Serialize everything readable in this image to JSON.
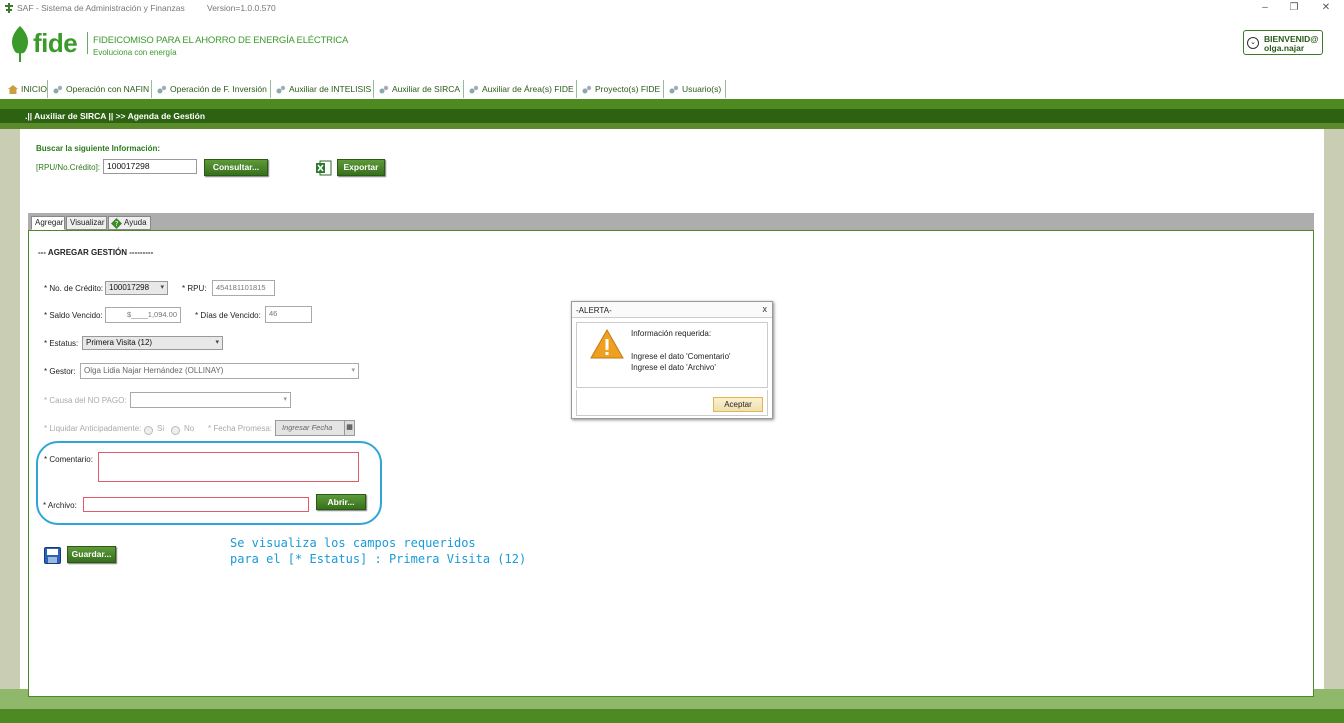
{
  "window": {
    "title": "SAF - Sistema de Administración y Finanzas",
    "version": "Version=1.0.0.570",
    "controls": [
      "–",
      "❐",
      "✕"
    ]
  },
  "brand": {
    "name": "fide",
    "line1": "FIDEICOMISO PARA EL AHORRO DE ENERGÍA ELÉCTRICA",
    "line2": "Evoluciona con energía",
    "color": "#3a9a2a"
  },
  "user": {
    "greeting": "BIENVENID@",
    "username": "olga.najar"
  },
  "menu": [
    {
      "label": "INICIO",
      "icon": "home-icon"
    },
    {
      "label": "Operación con NAFIN",
      "icon": "gears-icon"
    },
    {
      "label": "Operación de F. Inversión",
      "icon": "gears-icon"
    },
    {
      "label": "Auxiliar de INTELISIS",
      "icon": "gears-icon"
    },
    {
      "label": "Auxiliar de SIRCA",
      "icon": "gears-icon"
    },
    {
      "label": "Auxiliar de Área(s) FIDE",
      "icon": "gears-icon"
    },
    {
      "label": "Proyecto(s) FIDE",
      "icon": "gears-icon"
    },
    {
      "label": "Usuario(s)",
      "icon": "gears-icon"
    }
  ],
  "breadcrumb": ".|| Auxiliar de SIRCA ||  >> Agenda de Gestión",
  "search": {
    "heading": "Buscar la siguiente Información:",
    "label": "[RPU/No.Crédito]:",
    "value": "100017298",
    "consult_button": "Consultar...",
    "export_button": "Exportar"
  },
  "tabs": [
    {
      "label": "Agregar"
    },
    {
      "label": "Visualizar"
    },
    {
      "label": "Ayuda"
    }
  ],
  "form": {
    "section_title": "--- AGREGAR GESTIÓN ---------",
    "credit_label": "* No. de Crédito:",
    "credit_value": "100017298",
    "rpu_label": "* RPU:",
    "rpu_value": "454181101815",
    "saldo_label": "* Saldo Vencido:",
    "saldo_value": "$____1,094.00",
    "dias_label": "* Días de Vencido:",
    "dias_value": "46",
    "estatus_label": "* Estatus:",
    "estatus_value": "Primera Visita (12)",
    "gestor_label": "* Gestor:",
    "gestor_value": "Olga Lidia Najar Hernández (OLLINAY)",
    "causa_label": "* Causa del NO PAGO:",
    "causa_value": "",
    "liquidar_label": "* Liquidar Anticipadamente:",
    "si_label": "Si",
    "no_label": "No",
    "fecha_label": "* Fecha Promesa:",
    "fecha_placeholder": "Ingresar Fecha",
    "comentario_label": "* Comentario:",
    "archivo_label": "* Archivo:",
    "abrir_button": "Abrir...",
    "guardar_button": "Guardar..."
  },
  "annotation": {
    "line1": "Se visualiza los campos requeridos",
    "line2": "para el [* Estatus] : Primera Visita (12)",
    "color": "#1a9ad8"
  },
  "alert": {
    "title": "-ALERTA-",
    "close": "x",
    "heading": "Información requerida:",
    "msg1": "Ingrese el dato 'Comentario'",
    "msg2": "Ingrese el dato 'Archivo'",
    "accept": "Aceptar"
  },
  "colors": {
    "primary_green": "#4e8a22",
    "dark_green": "#2c6212",
    "required_border": "#e05a6a",
    "highlight": "#2ea6d8"
  }
}
